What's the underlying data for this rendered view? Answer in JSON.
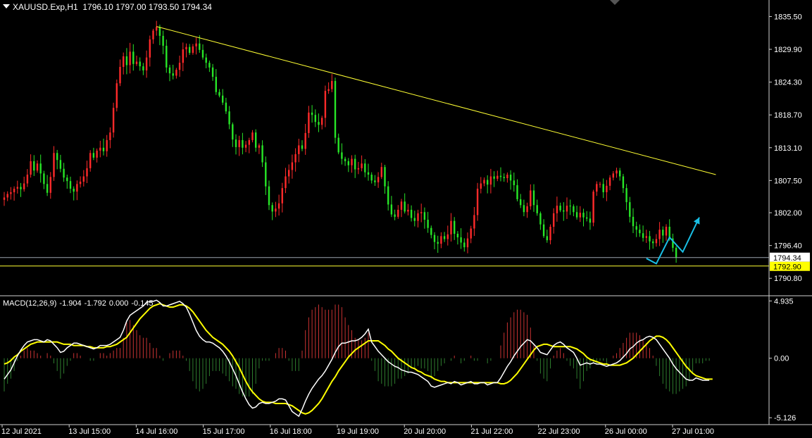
{
  "header": {
    "symbol": "XAUUSD.Exp,H1",
    "ohlc": [
      "1796.10",
      "1797.00",
      "1793.50",
      "1794.34"
    ]
  },
  "colors": {
    "background": "#000000",
    "bull": "#ff2a2a",
    "bear": "#27e627",
    "trendline": "#ffff33",
    "arrow": "#19bfe5",
    "macd_line": "#ffffff",
    "signal_line": "#ffff00",
    "hist_pos": "#c83232",
    "hist_neg": "#2e7d2e",
    "current_label_bg": "#ffffff",
    "support_label_bg": "#ffff00"
  },
  "chart_data": [
    {
      "type": "candlestick",
      "ylim": [
        1788.3,
        1837.6
      ],
      "y_ticks": [
        "1835.50",
        "1829.90",
        "1824.30",
        "1818.70",
        "1813.10",
        "1807.50",
        "1802.00",
        "1796.40",
        "1790.80"
      ],
      "x_ticks": [
        "12 Jul 2021",
        "13 Jul 15:00",
        "14 Jul 16:00",
        "15 Jul 17:00",
        "16 Jul 18:00",
        "19 Jul 19:00",
        "20 Jul 20:00",
        "21 Jul 22:00",
        "22 Jul 23:00",
        "26 Jul 00:00",
        "27 Jul 01:00"
      ],
      "bar_count": 215,
      "closes": [
        1804.6,
        1805.2,
        1805.5,
        1806.1,
        1806.4,
        1806.0,
        1807.0,
        1808.5,
        1810.8,
        1809.2,
        1810.4,
        1808.7,
        1806.9,
        1805.4,
        1808.1,
        1812.2,
        1811.0,
        1809.5,
        1808.0,
        1807.4,
        1806.1,
        1805.6,
        1806.9,
        1807.3,
        1808.2,
        1809.6,
        1812.2,
        1811.4,
        1812.6,
        1813.1,
        1812.5,
        1814.4,
        1815.7,
        1819.9,
        1824.1,
        1826.9,
        1828.7,
        1827.2,
        1829.5,
        1827.4,
        1827.8,
        1827.0,
        1826.3,
        1828.5,
        1831.6,
        1833.1,
        1833.7,
        1832.2,
        1830.5,
        1826.8,
        1825.8,
        1825.4,
        1826.4,
        1827.6,
        1829.9,
        1830.3,
        1829.3,
        1830.4,
        1830.9,
        1829.8,
        1828.5,
        1827.6,
        1826.8,
        1825.2,
        1822.6,
        1822.0,
        1820.8,
        1819.3,
        1817.1,
        1814.5,
        1813.2,
        1814.4,
        1813.1,
        1813.6,
        1814.4,
        1815.7,
        1813.1,
        1813.5,
        1810.6,
        1806.5,
        1803.3,
        1802.2,
        1802.7,
        1803.6,
        1806.2,
        1808.2,
        1809.3,
        1810.6,
        1812.0,
        1813.5,
        1812.9,
        1815.6,
        1819.1,
        1818.7,
        1817.5,
        1817.0,
        1818.2,
        1822.8,
        1823.1,
        1824.5,
        1814.8,
        1812.3,
        1811.2,
        1810.8,
        1810.1,
        1811.2,
        1809.4,
        1809.6,
        1810.4,
        1808.9,
        1808.5,
        1807.5,
        1807.2,
        1808.1,
        1809.8,
        1806.5,
        1803.4,
        1801.7,
        1801.3,
        1802.5,
        1803.9,
        1802.2,
        1802.5,
        1801.1,
        1800.6,
        1801.9,
        1802.1,
        1800.8,
        1799.4,
        1798.2,
        1797.0,
        1796.7,
        1798.0,
        1797.5,
        1798.3,
        1800.6,
        1798.4,
        1797.8,
        1796.9,
        1796.1,
        1797.6,
        1799.3,
        1801.6,
        1806.1,
        1807.0,
        1807.6,
        1806.8,
        1808.2,
        1807.8,
        1808.3,
        1808.1,
        1807.9,
        1808.5,
        1807.5,
        1806.7,
        1804.3,
        1803.3,
        1802.1,
        1803.1,
        1805.8,
        1803.3,
        1801.9,
        1800.0,
        1798.0,
        1797.3,
        1799.6,
        1801.9,
        1803.2,
        1802.4,
        1802.2,
        1803.2,
        1803.1,
        1802.1,
        1801.2,
        1802.0,
        1801.2,
        1801.0,
        1800.3,
        1805.6,
        1806.9,
        1806.9,
        1805.5,
        1806.6,
        1808.0,
        1808.7,
        1809.2,
        1808.2,
        1806.2,
        1803.8,
        1801.3,
        1799.7,
        1799.1,
        1798.5,
        1797.7,
        1798.0,
        1797.1,
        1796.8,
        1797.5,
        1799.1,
        1798.1,
        1799.6,
        1797.6,
        1796.0,
        1794.34
      ],
      "trendline": {
        "from": {
          "bar": 46,
          "price": 1833.8
        },
        "to": {
          "bar": 215,
          "price": 1808.5
        }
      },
      "current_price": "1794.34",
      "support_level": "1792.90",
      "projection_path": [
        {
          "bar": 194,
          "price": 1794.2
        },
        {
          "bar": 197,
          "price": 1793.3
        },
        {
          "bar": 201,
          "price": 1797.8
        },
        {
          "bar": 205,
          "price": 1795.3
        },
        {
          "bar": 210,
          "price": 1801.2
        }
      ]
    },
    {
      "type": "macd",
      "label": "MACD(12,26,9) -1.904 -1.792 0.000 -0.145",
      "label_parts": [
        "MACD(12,26,9)",
        "-1.904",
        "-1.792",
        "0.000",
        "-0.145"
      ],
      "ylim": [
        -5.6,
        5.2
      ],
      "y_ticks": [
        "4.935",
        "0.00",
        "-5.126"
      ],
      "macd_line": [
        -1.8,
        -1.4,
        -1.0,
        -0.4,
        0.2,
        0.7,
        1.1,
        1.4,
        1.5,
        1.6,
        1.6,
        1.5,
        1.4,
        1.6,
        1.5,
        1.2,
        0.9,
        0.5,
        0.6,
        0.9,
        1.1,
        1.3,
        1.3,
        1.2,
        1.1,
        1.0,
        0.9,
        0.8,
        0.9,
        1.1,
        1.1,
        1.1,
        1.2,
        1.4,
        1.6,
        1.8,
        2.4,
        3.2,
        3.7,
        3.9,
        4.1,
        4.3,
        4.5,
        4.8,
        4.9,
        4.9,
        5.0,
        4.8,
        4.5,
        4.5,
        4.6,
        4.7,
        4.8,
        4.9,
        4.7,
        4.4,
        3.8,
        3.1,
        2.4,
        1.9,
        1.6,
        1.4,
        1.4,
        1.3,
        1.1,
        0.9,
        0.6,
        0.2,
        -0.3,
        -0.9,
        -1.5,
        -2.2,
        -2.9,
        -3.5,
        -4.0,
        -4.3,
        -4.2,
        -3.9,
        -3.8,
        -3.9,
        -3.9,
        -3.8,
        -3.7,
        -3.5,
        -3.5,
        -3.6,
        -4.1,
        -4.6,
        -4.8,
        -5.0,
        -4.4,
        -3.7,
        -3.1,
        -2.6,
        -2.2,
        -1.8,
        -1.5,
        -1.1,
        -0.6,
        -0.1,
        0.5,
        1.0,
        1.3,
        1.3,
        1.4,
        1.5,
        1.5,
        1.6,
        1.8,
        2.1,
        2.5,
        1.4,
        1.0,
        0.6,
        0.3,
        0.0,
        -0.3,
        -0.5,
        -0.7,
        -0.8,
        -1.0,
        -1.1,
        -1.2,
        -1.2,
        -1.3,
        -1.4,
        -1.6,
        -1.8,
        -2.0,
        -2.4,
        -2.5,
        -2.4,
        -2.3,
        -2.2,
        -2.1,
        -2.2,
        -2.0,
        -2.1,
        -2.3,
        -2.2,
        -2.1,
        -2.0,
        -2.2,
        -2.2,
        -2.1,
        -2.1,
        -2.3,
        -2.2,
        -2.1,
        -2.1,
        -1.7,
        -1.2,
        -0.7,
        -0.3,
        0.2,
        0.6,
        1.0,
        1.3,
        1.6,
        1.5,
        1.2,
        0.9,
        0.5,
        0.4,
        0.3,
        0.7,
        1.1,
        1.3,
        1.4,
        1.2,
        0.9,
        0.7,
        0.5,
        0.0,
        -0.6,
        -0.5,
        -0.4,
        -0.5,
        -0.4,
        -0.5,
        -0.5,
        -0.6,
        -0.7,
        -0.6,
        -0.5,
        -0.4,
        -0.2,
        0.1,
        0.4,
        0.8,
        1.0,
        1.3,
        1.5,
        1.6,
        1.8,
        1.9,
        1.8,
        1.6,
        1.2,
        0.8,
        0.4,
        0.0,
        -0.5,
        -0.9,
        -1.2,
        -1.5,
        -1.8,
        -1.9,
        -1.9,
        -1.7,
        -1.8,
        -1.9,
        -1.9,
        -1.9
      ],
      "signal_line": [
        -0.5,
        -0.4,
        -0.2,
        0.1,
        0.3,
        0.6,
        0.8,
        1.0,
        1.2,
        1.3,
        1.4,
        1.4,
        1.4,
        1.4,
        1.4,
        1.4,
        1.4,
        1.3,
        1.2,
        1.2,
        1.2,
        1.1,
        1.1,
        1.1,
        1.1,
        1.0,
        1.0,
        0.9,
        0.9,
        0.9,
        0.9,
        1.0,
        1.0,
        1.1,
        1.2,
        1.4,
        1.6,
        1.8,
        2.2,
        2.6,
        3.0,
        3.4,
        3.7,
        4.0,
        4.3,
        4.5,
        4.6,
        4.7,
        4.6,
        4.5,
        4.4,
        4.4,
        4.5,
        4.6,
        4.6,
        4.5,
        4.3,
        4.0,
        3.6,
        3.2,
        2.8,
        2.4,
        2.1,
        1.8,
        1.6,
        1.4,
        1.2,
        0.9,
        0.6,
        0.2,
        -0.3,
        -0.8,
        -1.4,
        -2.0,
        -2.5,
        -2.9,
        -3.2,
        -3.5,
        -3.7,
        -3.8,
        -3.8,
        -3.8,
        -3.9,
        -3.9,
        -3.9,
        -3.9,
        -4.0,
        -4.1,
        -4.3,
        -4.5,
        -4.7,
        -4.8,
        -4.7,
        -4.5,
        -4.2,
        -3.9,
        -3.5,
        -3.0,
        -2.5,
        -2.0,
        -1.6,
        -1.1,
        -0.7,
        -0.3,
        0.1,
        0.4,
        0.7,
        0.9,
        1.1,
        1.3,
        1.5,
        1.5,
        1.5,
        1.5,
        1.3,
        1.1,
        0.8,
        0.6,
        0.3,
        0.0,
        -0.2,
        -0.4,
        -0.6,
        -0.8,
        -0.9,
        -1.1,
        -1.2,
        -1.4,
        -1.5,
        -1.6,
        -1.8,
        -1.9,
        -2.0,
        -2.0,
        -2.1,
        -2.1,
        -2.1,
        -2.1,
        -2.1,
        -2.1,
        -2.1,
        -2.1,
        -2.1,
        -2.1,
        -2.1,
        -2.1,
        -2.1,
        -2.1,
        -2.1,
        -2.1,
        -2.2,
        -2.2,
        -2.1,
        -1.9,
        -1.6,
        -1.3,
        -0.9,
        -0.5,
        -0.1,
        0.3,
        0.7,
        1.0,
        1.1,
        1.2,
        1.2,
        1.1,
        1.0,
        1.0,
        1.0,
        1.0,
        1.0,
        1.0,
        0.9,
        0.8,
        0.6,
        0.4,
        0.1,
        -0.1,
        -0.2,
        -0.3,
        -0.4,
        -0.5,
        -0.5,
        -0.6,
        -0.6,
        -0.6,
        -0.6,
        -0.5,
        -0.4,
        -0.2,
        0.0,
        0.3,
        0.6,
        0.9,
        1.2,
        1.5,
        1.7,
        1.9,
        1.9,
        1.8,
        1.6,
        1.3,
        0.9,
        0.5,
        0.1,
        -0.3,
        -0.7,
        -1.0,
        -1.3,
        -1.5,
        -1.6,
        -1.7,
        -1.8,
        -1.8,
        -1.8
      ]
    }
  ]
}
